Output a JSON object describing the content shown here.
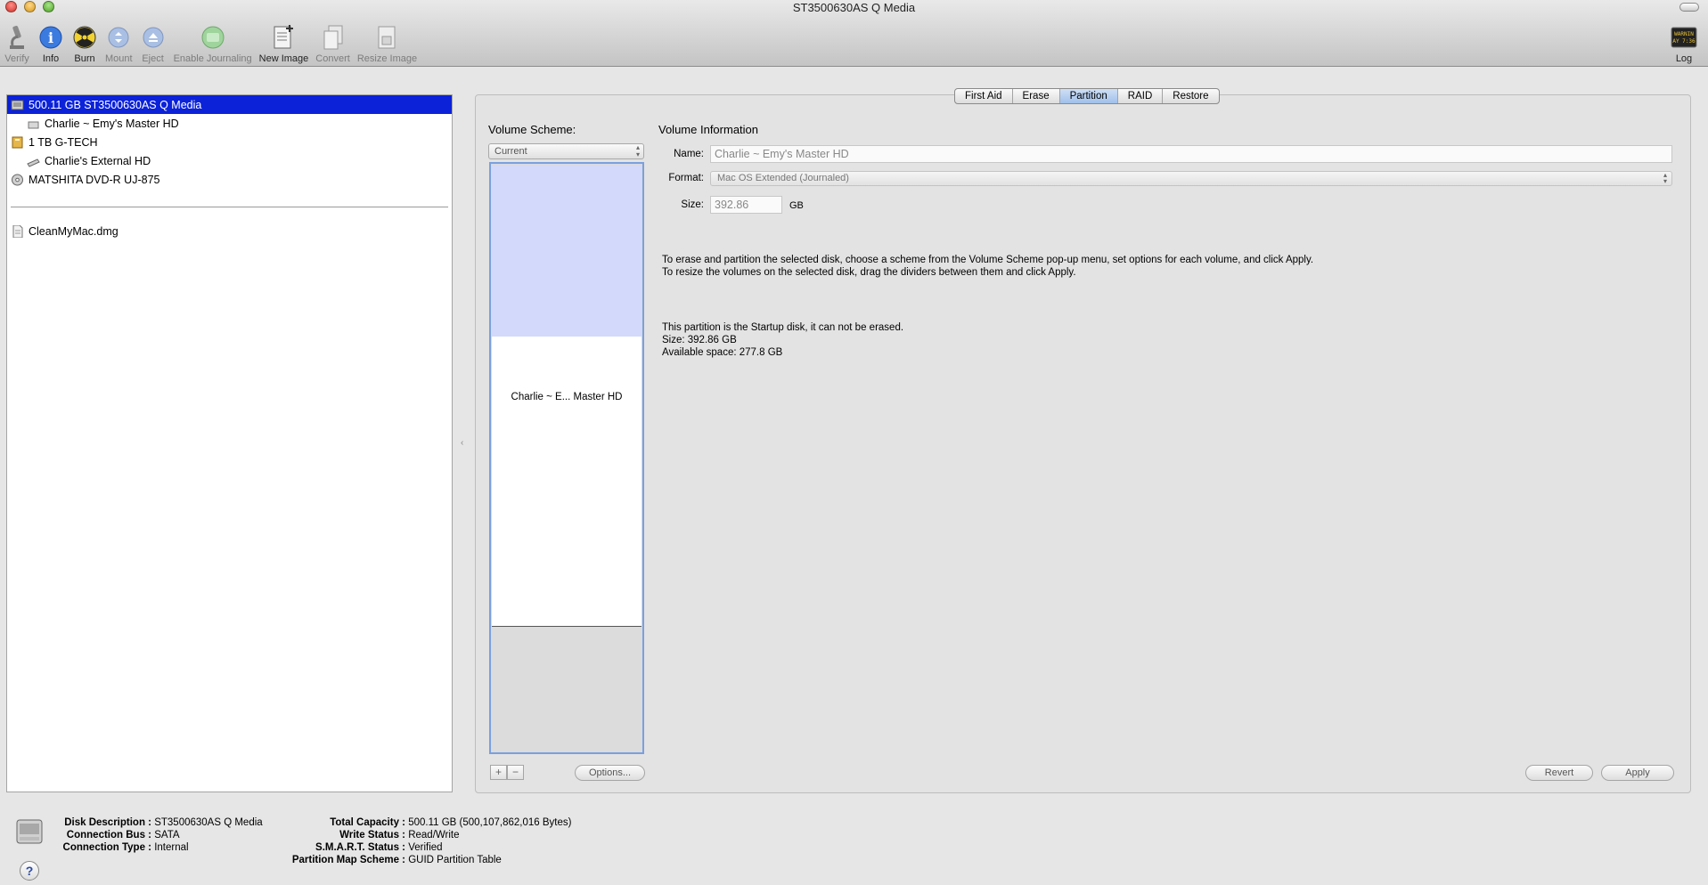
{
  "window": {
    "title": "ST3500630AS Q Media"
  },
  "toolbar": {
    "items": [
      {
        "label": "Verify",
        "icon": "microscope-icon",
        "enabled": false
      },
      {
        "label": "Info",
        "icon": "info-icon",
        "enabled": true
      },
      {
        "label": "Burn",
        "icon": "burn-icon",
        "enabled": true
      },
      {
        "label": "Mount",
        "icon": "mount-icon",
        "enabled": false
      },
      {
        "label": "Eject",
        "icon": "eject-icon",
        "enabled": false
      },
      {
        "label": "Enable Journaling",
        "icon": "journaling-icon",
        "enabled": false
      },
      {
        "label": "New Image",
        "icon": "new-image-icon",
        "enabled": true
      },
      {
        "label": "Convert",
        "icon": "convert-icon",
        "enabled": false
      },
      {
        "label": "Resize Image",
        "icon": "resize-image-icon",
        "enabled": false
      }
    ],
    "log": {
      "label": "Log",
      "icon_text": "WARNIN AY 7:36"
    }
  },
  "sidebar": {
    "items": [
      {
        "label": "500.11 GB ST3500630AS Q Media",
        "icon": "hard-disk-icon",
        "selected": true
      },
      {
        "label": "Charlie ~ Emy's Master HD",
        "icon": "volume-icon",
        "selected": false
      },
      {
        "label": "1 TB G-TECH",
        "icon": "external-disk-icon",
        "selected": false
      },
      {
        "label": "Charlie's External HD",
        "icon": "external-volume-icon",
        "selected": false
      },
      {
        "label": "MATSHITA DVD-R UJ-875",
        "icon": "dvd-drive-icon",
        "selected": false
      }
    ],
    "images": [
      {
        "label": "CleanMyMac.dmg",
        "icon": "dmg-file-icon"
      }
    ]
  },
  "tabs": [
    {
      "label": "First Aid",
      "active": false
    },
    {
      "label": "Erase",
      "active": false
    },
    {
      "label": "Partition",
      "active": true
    },
    {
      "label": "RAID",
      "active": false
    },
    {
      "label": "Restore",
      "active": false
    }
  ],
  "partition": {
    "volume_scheme_label": "Volume Scheme:",
    "volume_scheme_value": "Current",
    "map_partition_label": "Charlie ~ E... Master HD",
    "add_label": "+",
    "remove_label": "−",
    "options_label": "Options...",
    "volume_info_title": "Volume Information",
    "name_label": "Name:",
    "name_value": "Charlie ~ Emy's Master HD",
    "format_label": "Format:",
    "format_value": "Mac OS Extended (Journaled)",
    "size_label": "Size:",
    "size_value": "392.86",
    "size_unit": "GB",
    "instructions_1": "To erase and partition the selected disk, choose a scheme from the Volume Scheme pop-up menu, set options for each volume, and click Apply.",
    "instructions_2": "To resize the volumes on the selected disk, drag the dividers between them and click Apply.",
    "startup_note": "This partition is the Startup disk, it can not be erased.",
    "size_line": "Size: 392.86 GB",
    "available_line": "Available space: 277.8 GB",
    "revert_label": "Revert",
    "apply_label": "Apply"
  },
  "disk_info": {
    "description_key": "Disk Description :",
    "description_val": "ST3500630AS Q Media",
    "bus_key": "Connection Bus :",
    "bus_val": "SATA",
    "type_key": "Connection Type :",
    "type_val": "Internal",
    "capacity_key": "Total Capacity :",
    "capacity_val": "500.11 GB (500,107,862,016 Bytes)",
    "write_key": "Write Status :",
    "write_val": "Read/Write",
    "smart_key": "S.M.A.R.T. Status :",
    "smart_val": "Verified",
    "map_key": "Partition Map Scheme :",
    "map_val": "GUID Partition Table",
    "help_label": "?"
  }
}
